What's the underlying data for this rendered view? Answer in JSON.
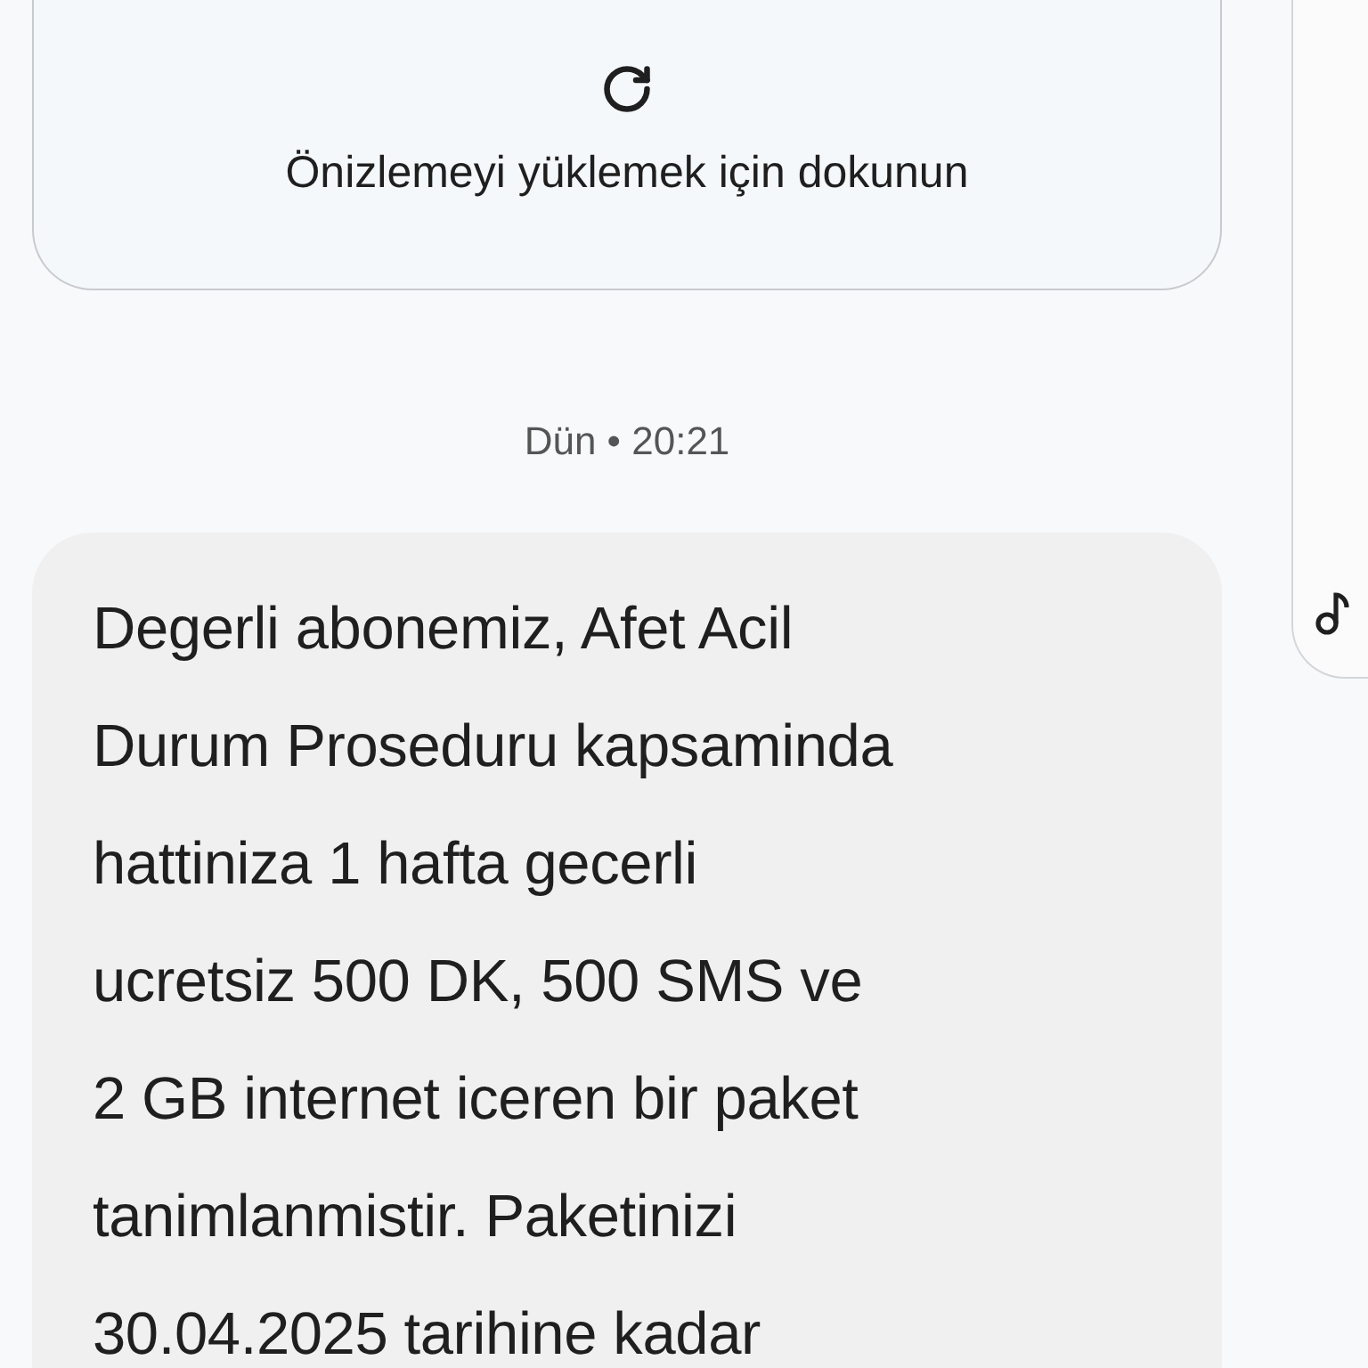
{
  "link_preview": {
    "action": "Önizlemeyi yüklemek için dokunun"
  },
  "timestamp": "Dün • 20:21",
  "message": {
    "text": "Degerli abonemiz, Afet Acil\nDurum Proseduru kapsaminda\nhattiniza 1 hafta gecerli\nucretsiz 500 DK, 500 SMS ve\n2 GB internet iceren bir paket\ntanimlanmistir. Paketinizi\n30.04.2025 tarihine kadar"
  }
}
